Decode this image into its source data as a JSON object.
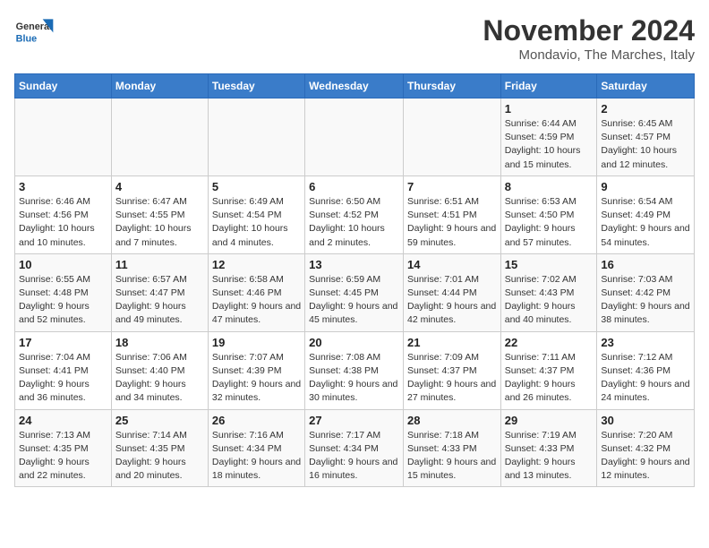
{
  "logo": {
    "general": "General",
    "blue": "Blue"
  },
  "header": {
    "month": "November 2024",
    "location": "Mondavio, The Marches, Italy"
  },
  "weekdays": [
    "Sunday",
    "Monday",
    "Tuesday",
    "Wednesday",
    "Thursday",
    "Friday",
    "Saturday"
  ],
  "weeks": [
    [
      {
        "day": "",
        "info": ""
      },
      {
        "day": "",
        "info": ""
      },
      {
        "day": "",
        "info": ""
      },
      {
        "day": "",
        "info": ""
      },
      {
        "day": "",
        "info": ""
      },
      {
        "day": "1",
        "info": "Sunrise: 6:44 AM\nSunset: 4:59 PM\nDaylight: 10 hours and 15 minutes."
      },
      {
        "day": "2",
        "info": "Sunrise: 6:45 AM\nSunset: 4:57 PM\nDaylight: 10 hours and 12 minutes."
      }
    ],
    [
      {
        "day": "3",
        "info": "Sunrise: 6:46 AM\nSunset: 4:56 PM\nDaylight: 10 hours and 10 minutes."
      },
      {
        "day": "4",
        "info": "Sunrise: 6:47 AM\nSunset: 4:55 PM\nDaylight: 10 hours and 7 minutes."
      },
      {
        "day": "5",
        "info": "Sunrise: 6:49 AM\nSunset: 4:54 PM\nDaylight: 10 hours and 4 minutes."
      },
      {
        "day": "6",
        "info": "Sunrise: 6:50 AM\nSunset: 4:52 PM\nDaylight: 10 hours and 2 minutes."
      },
      {
        "day": "7",
        "info": "Sunrise: 6:51 AM\nSunset: 4:51 PM\nDaylight: 9 hours and 59 minutes."
      },
      {
        "day": "8",
        "info": "Sunrise: 6:53 AM\nSunset: 4:50 PM\nDaylight: 9 hours and 57 minutes."
      },
      {
        "day": "9",
        "info": "Sunrise: 6:54 AM\nSunset: 4:49 PM\nDaylight: 9 hours and 54 minutes."
      }
    ],
    [
      {
        "day": "10",
        "info": "Sunrise: 6:55 AM\nSunset: 4:48 PM\nDaylight: 9 hours and 52 minutes."
      },
      {
        "day": "11",
        "info": "Sunrise: 6:57 AM\nSunset: 4:47 PM\nDaylight: 9 hours and 49 minutes."
      },
      {
        "day": "12",
        "info": "Sunrise: 6:58 AM\nSunset: 4:46 PM\nDaylight: 9 hours and 47 minutes."
      },
      {
        "day": "13",
        "info": "Sunrise: 6:59 AM\nSunset: 4:45 PM\nDaylight: 9 hours and 45 minutes."
      },
      {
        "day": "14",
        "info": "Sunrise: 7:01 AM\nSunset: 4:44 PM\nDaylight: 9 hours and 42 minutes."
      },
      {
        "day": "15",
        "info": "Sunrise: 7:02 AM\nSunset: 4:43 PM\nDaylight: 9 hours and 40 minutes."
      },
      {
        "day": "16",
        "info": "Sunrise: 7:03 AM\nSunset: 4:42 PM\nDaylight: 9 hours and 38 minutes."
      }
    ],
    [
      {
        "day": "17",
        "info": "Sunrise: 7:04 AM\nSunset: 4:41 PM\nDaylight: 9 hours and 36 minutes."
      },
      {
        "day": "18",
        "info": "Sunrise: 7:06 AM\nSunset: 4:40 PM\nDaylight: 9 hours and 34 minutes."
      },
      {
        "day": "19",
        "info": "Sunrise: 7:07 AM\nSunset: 4:39 PM\nDaylight: 9 hours and 32 minutes."
      },
      {
        "day": "20",
        "info": "Sunrise: 7:08 AM\nSunset: 4:38 PM\nDaylight: 9 hours and 30 minutes."
      },
      {
        "day": "21",
        "info": "Sunrise: 7:09 AM\nSunset: 4:37 PM\nDaylight: 9 hours and 27 minutes."
      },
      {
        "day": "22",
        "info": "Sunrise: 7:11 AM\nSunset: 4:37 PM\nDaylight: 9 hours and 26 minutes."
      },
      {
        "day": "23",
        "info": "Sunrise: 7:12 AM\nSunset: 4:36 PM\nDaylight: 9 hours and 24 minutes."
      }
    ],
    [
      {
        "day": "24",
        "info": "Sunrise: 7:13 AM\nSunset: 4:35 PM\nDaylight: 9 hours and 22 minutes."
      },
      {
        "day": "25",
        "info": "Sunrise: 7:14 AM\nSunset: 4:35 PM\nDaylight: 9 hours and 20 minutes."
      },
      {
        "day": "26",
        "info": "Sunrise: 7:16 AM\nSunset: 4:34 PM\nDaylight: 9 hours and 18 minutes."
      },
      {
        "day": "27",
        "info": "Sunrise: 7:17 AM\nSunset: 4:34 PM\nDaylight: 9 hours and 16 minutes."
      },
      {
        "day": "28",
        "info": "Sunrise: 7:18 AM\nSunset: 4:33 PM\nDaylight: 9 hours and 15 minutes."
      },
      {
        "day": "29",
        "info": "Sunrise: 7:19 AM\nSunset: 4:33 PM\nDaylight: 9 hours and 13 minutes."
      },
      {
        "day": "30",
        "info": "Sunrise: 7:20 AM\nSunset: 4:32 PM\nDaylight: 9 hours and 12 minutes."
      }
    ]
  ]
}
